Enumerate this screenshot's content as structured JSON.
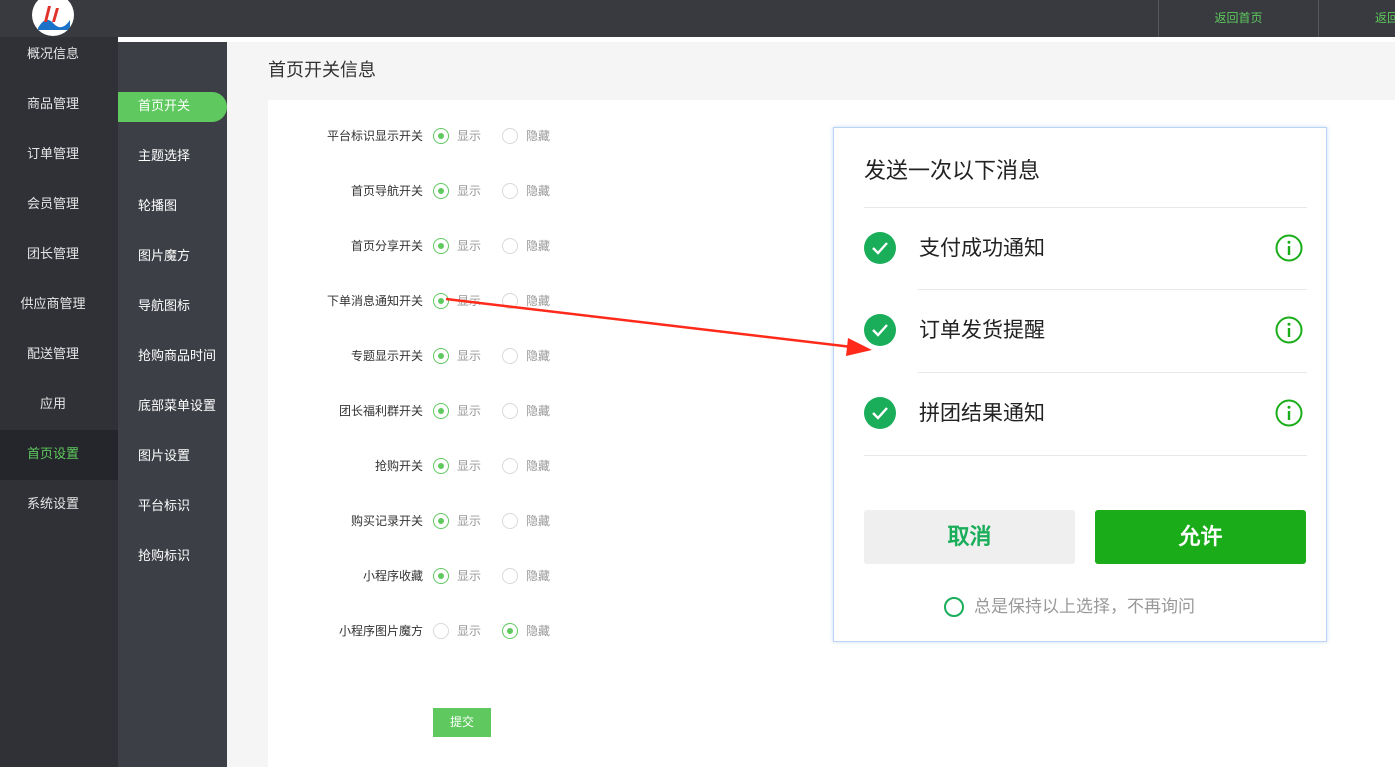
{
  "header": {
    "link_home": "返回首页",
    "link_home_2": "返回"
  },
  "sidebar": {
    "items": [
      {
        "label": "概况信息"
      },
      {
        "label": "商品管理"
      },
      {
        "label": "订单管理"
      },
      {
        "label": "会员管理"
      },
      {
        "label": "团长管理"
      },
      {
        "label": "供应商管理"
      },
      {
        "label": "配送管理"
      },
      {
        "label": "应用"
      },
      {
        "label": "首页设置",
        "active": true
      },
      {
        "label": "系统设置"
      }
    ]
  },
  "submenu": {
    "items": [
      {
        "label": "首页开关",
        "active": true
      },
      {
        "label": "主题选择"
      },
      {
        "label": "轮播图"
      },
      {
        "label": "图片魔方"
      },
      {
        "label": "导航图标"
      },
      {
        "label": "抢购商品时间"
      },
      {
        "label": "底部菜单设置"
      },
      {
        "label": "图片设置"
      },
      {
        "label": "平台标识"
      },
      {
        "label": "抢购标识"
      }
    ]
  },
  "page": {
    "title": "首页开关信息",
    "show_label": "显示",
    "hide_label": "隐藏",
    "submit_label": "提交",
    "rows": [
      {
        "label": "平台标识显示开关",
        "selected": "show"
      },
      {
        "label": "首页导航开关",
        "selected": "show"
      },
      {
        "label": "首页分享开关",
        "selected": "show"
      },
      {
        "label": "下单消息通知开关",
        "selected": "show"
      },
      {
        "label": "专题显示开关",
        "selected": "show"
      },
      {
        "label": "团长福利群开关",
        "selected": "show"
      },
      {
        "label": "抢购开关",
        "selected": "show"
      },
      {
        "label": "购买记录开关",
        "selected": "show"
      },
      {
        "label": "小程序收藏",
        "selected": "show"
      },
      {
        "label": "小程序图片魔方",
        "selected": "hide"
      }
    ]
  },
  "dialog": {
    "title": "发送一次以下消息",
    "messages": [
      {
        "label": "支付成功通知"
      },
      {
        "label": "订单发货提醒"
      },
      {
        "label": "拼团结果通知"
      }
    ],
    "cancel_label": "取消",
    "allow_label": "允许",
    "keep_label": "总是保持以上选择，不再询问"
  },
  "colors": {
    "accent": "#5fc95f",
    "wechat_green": "#1aad19",
    "sidebar_bg": "#2f3137",
    "submenu_bg": "#3c3f46",
    "arrow": "#ff2a1a"
  }
}
